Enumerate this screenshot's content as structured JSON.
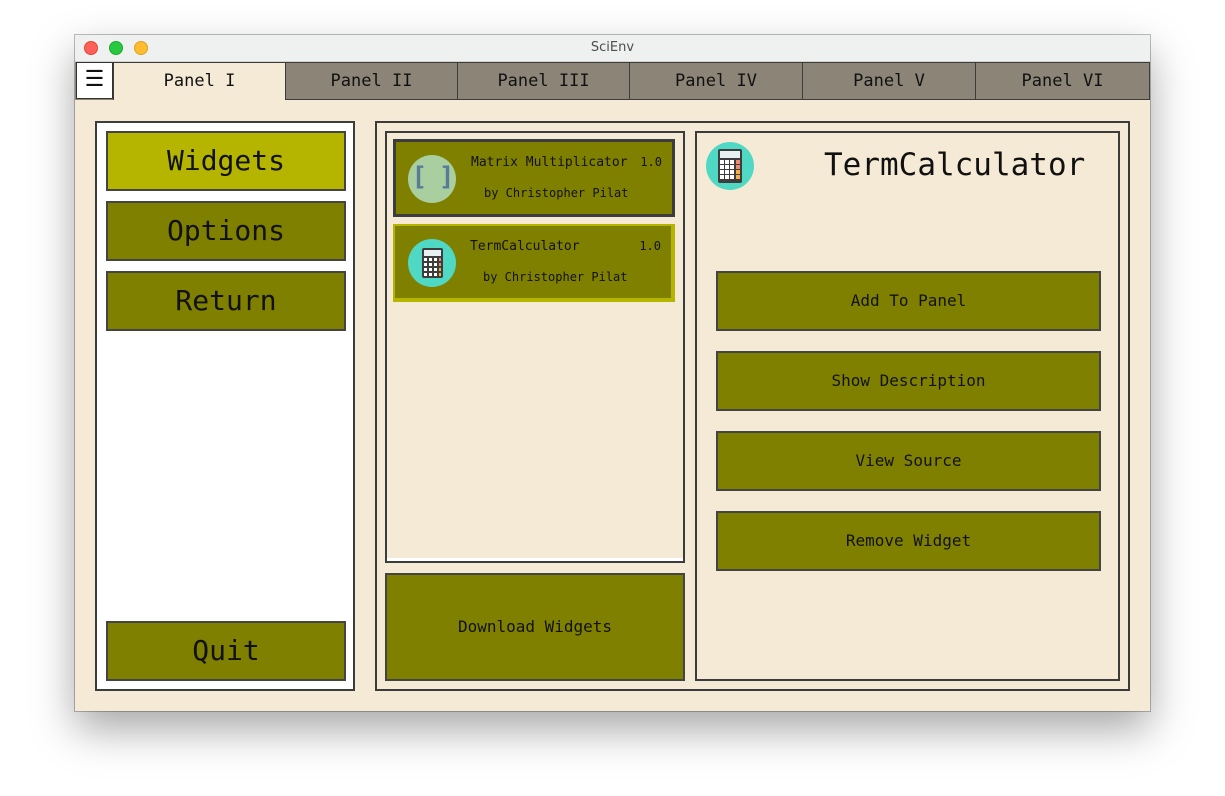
{
  "window": {
    "title": "SciEnv"
  },
  "menu": {
    "icon": "☰"
  },
  "tabs": [
    {
      "label": "Panel I"
    },
    {
      "label": "Panel II"
    },
    {
      "label": "Panel III"
    },
    {
      "label": "Panel IV"
    },
    {
      "label": "Panel V"
    },
    {
      "label": "Panel VI"
    }
  ],
  "nav": {
    "widgets": "Widgets",
    "options": "Options",
    "return": "Return",
    "quit": "Quit"
  },
  "widget_list": [
    {
      "name": "Matrix Multiplicator",
      "version": "1.0",
      "author": "by Christopher Pilat",
      "icon": "matrix-brackets-icon",
      "icon_text": "[ ]"
    },
    {
      "name": "TermCalculator",
      "version": "1.0",
      "author": "by Christopher Pilat",
      "icon": "calculator-icon"
    }
  ],
  "download_button": "Download Widgets",
  "detail": {
    "title": "TermCalculator",
    "icon": "calculator-icon",
    "actions": {
      "add": "Add To Panel",
      "describe": "Show Description",
      "source": "View Source",
      "remove": "Remove Widget"
    }
  },
  "colors": {
    "background": "#f5ead5",
    "olive": "#808000",
    "olive_active": "#b5b500",
    "tab_inactive": "#8b8477",
    "icon_teal": "#4fd8c4",
    "icon_sage": "#a9cfa0"
  }
}
